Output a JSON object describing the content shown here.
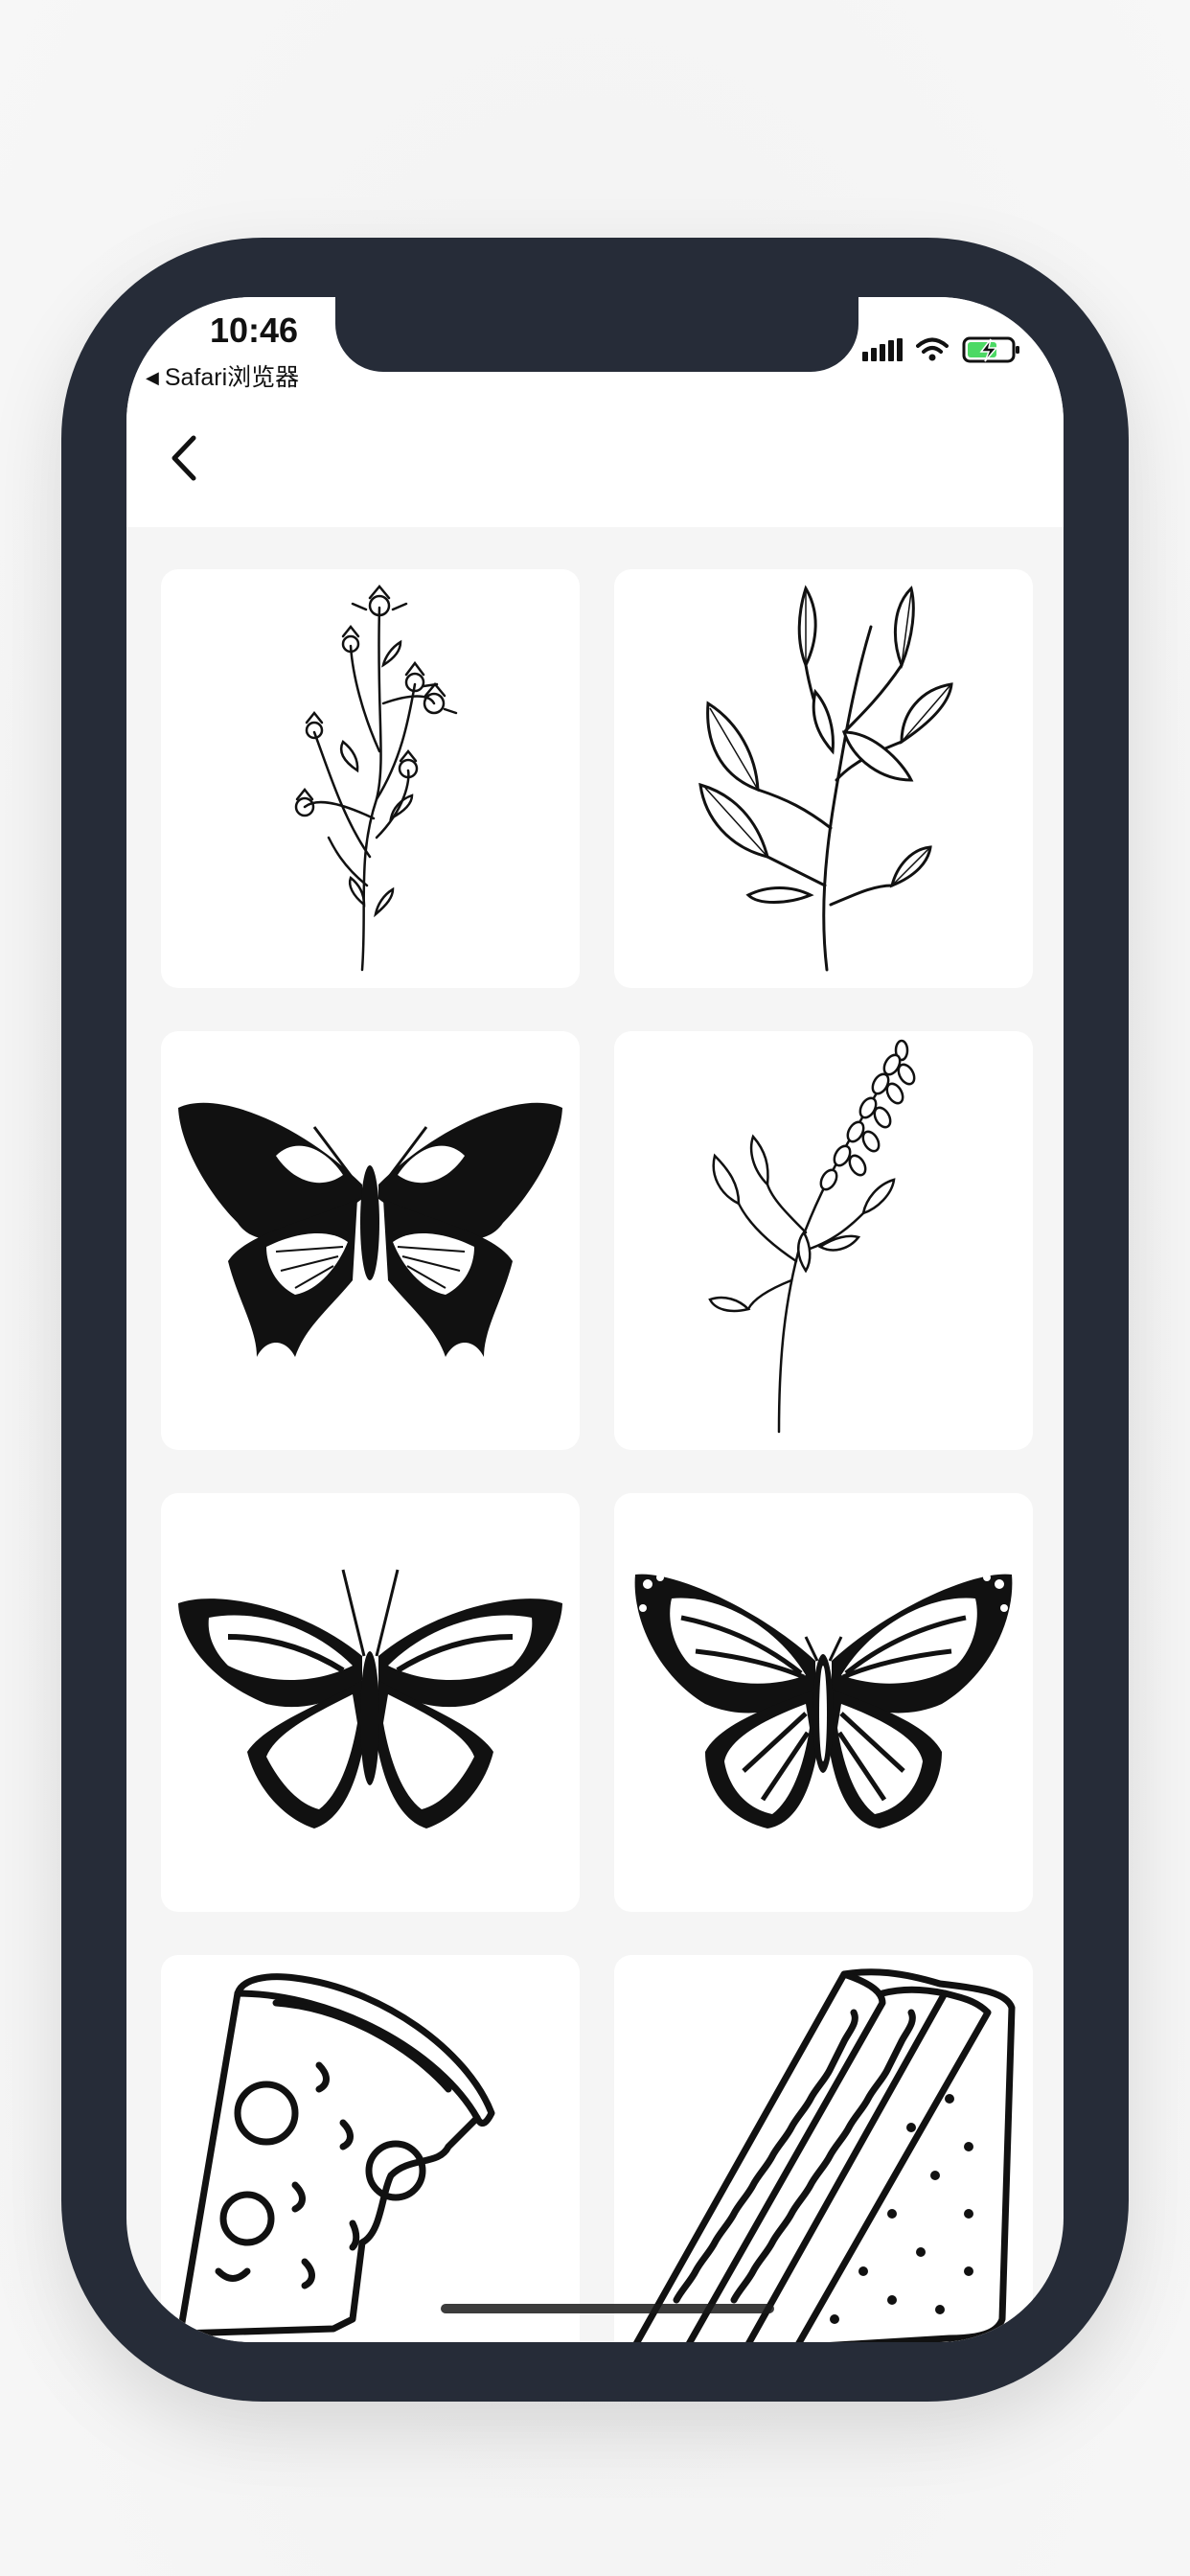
{
  "status_bar": {
    "time": "10:46",
    "back_app_label": "Safari浏览器"
  },
  "nav": {
    "back_icon": "chevron-left-icon"
  },
  "gallery": {
    "items": [
      {
        "subject": "wildflower-sprig"
      },
      {
        "subject": "leafy-branch"
      },
      {
        "subject": "swallowtail-butterfly"
      },
      {
        "subject": "lavender-sprig"
      },
      {
        "subject": "silhouette-butterfly"
      },
      {
        "subject": "monarch-butterfly"
      },
      {
        "subject": "pizza-slice"
      },
      {
        "subject": "sandwich"
      }
    ]
  },
  "colors": {
    "phone_frame": "#262c38",
    "card_bg": "#ffffff",
    "screen_bg": "#f5f5f5",
    "battery_charging": "#4cd964"
  }
}
